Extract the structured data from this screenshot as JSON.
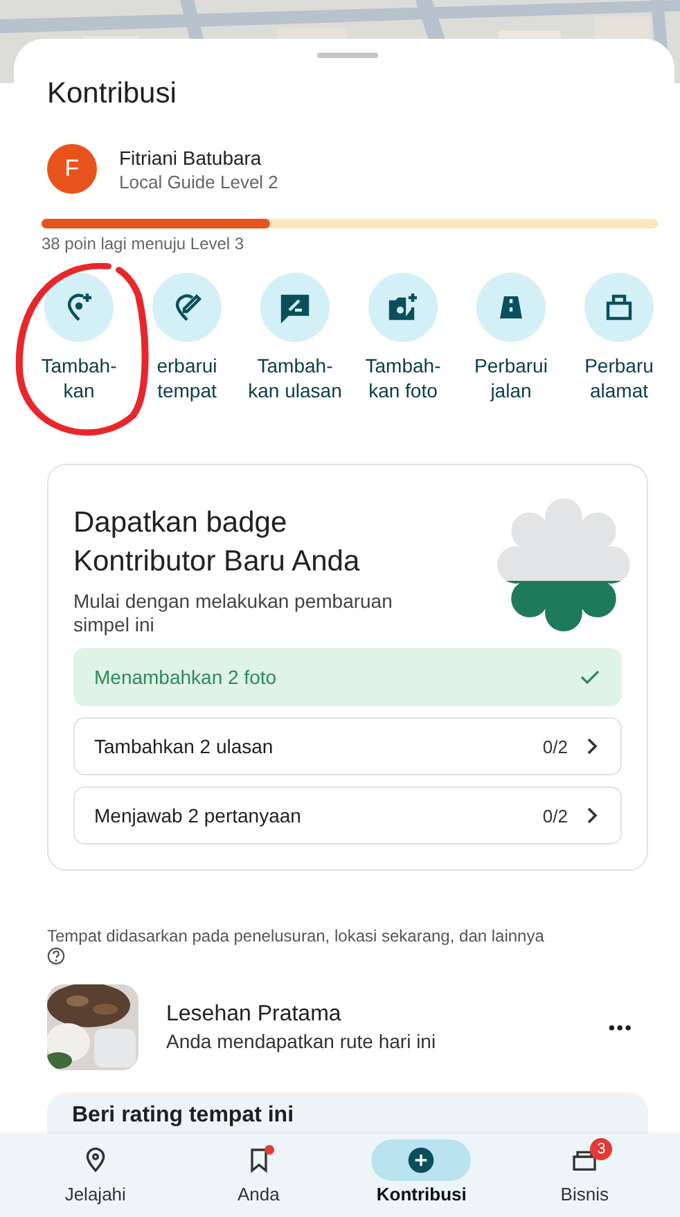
{
  "title": "Kontribusi",
  "profile": {
    "initial": "F",
    "name": "Fitriani Batubara",
    "level_label": "Local Guide Level 2",
    "level": 0.37,
    "progress_text": "38 poin lagi menuju Level 3"
  },
  "actions": [
    {
      "kind": "add-place",
      "lines": [
        "Tambah-",
        "kan"
      ]
    },
    {
      "kind": "edit-place",
      "lines": [
        "erbarui",
        "tempat"
      ]
    },
    {
      "kind": "review",
      "lines": [
        "Tambah-",
        "kan ulasan"
      ]
    },
    {
      "lines": [
        "Tambah-",
        "kan foto"
      ]
    },
    {
      "kind": "road",
      "lines": [
        "Perbarui",
        "jalan"
      ]
    },
    {
      "kind": "address",
      "lines": [
        "Perbaru",
        "alamat"
      ]
    }
  ],
  "badge_card": {
    "title_lines": [
      "Dapatkan badge",
      "Kontributor Baru Anda"
    ],
    "subtitle": "Mulai dengan melakukan pembaruan simpel ini",
    "tasks": [
      {
        "label": "Menambahkan 2 foto",
        "completed": true
      },
      {
        "label": "Tambahkan 2 ulasan",
        "completed": false,
        "progress": "0/2"
      },
      {
        "label": "Menjawab 2 pertanyaan",
        "completed": false,
        "progress": "0/2"
      }
    ]
  },
  "places_note": "Tempat didasarkan pada penelusuran, lokasi sekarang, dan lainnya",
  "place": {
    "name": "Lesehan Pratama",
    "subtitle": "Anda mendapatkan rute hari ini",
    "more": "•••"
  },
  "rating_card": {
    "title": "Beri rating tempat ini"
  },
  "nav": [
    {
      "kind": "explore",
      "label": "Jelajahi",
      "selected": false,
      "dot": false
    },
    {
      "kind": "saved",
      "label": "Anda",
      "selected": false,
      "dot": true
    },
    {
      "kind": "contribute",
      "label": "Kontribusi",
      "selected": true,
      "dot": false
    },
    {
      "kind": "business",
      "label": "Bisnis",
      "selected": false,
      "dot": false,
      "count": "3"
    }
  ]
}
